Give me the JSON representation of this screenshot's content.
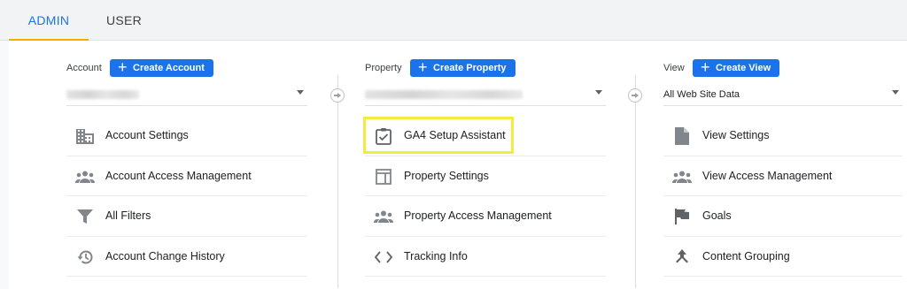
{
  "tabs": [
    {
      "label": "ADMIN",
      "active": true
    },
    {
      "label": "USER",
      "active": false
    }
  ],
  "colors": {
    "accent": "#1a73e8",
    "tab_underline": "#f9ab00",
    "highlight": "#f1ec41",
    "icon": "#80868b"
  },
  "columns": {
    "account": {
      "header": "Account",
      "create_label": "Create Account",
      "selected_value": "",
      "items": [
        {
          "label": "Account Settings",
          "icon": "building-icon"
        },
        {
          "label": "Account Access Management",
          "icon": "people-icon"
        },
        {
          "label": "All Filters",
          "icon": "filter-icon"
        },
        {
          "label": "Account Change History",
          "icon": "history-icon"
        }
      ]
    },
    "property": {
      "header": "Property",
      "create_label": "Create Property",
      "selected_value": "",
      "items": [
        {
          "label": "GA4 Setup Assistant",
          "icon": "clipboard-check-icon"
        },
        {
          "label": "Property Settings",
          "icon": "layout-icon"
        },
        {
          "label": "Property Access Management",
          "icon": "people-icon"
        },
        {
          "label": "Tracking Info",
          "icon": "code-icon"
        }
      ]
    },
    "view": {
      "header": "View",
      "create_label": "Create View",
      "selected_value": "All Web Site Data",
      "items": [
        {
          "label": "View Settings",
          "icon": "document-icon"
        },
        {
          "label": "View Access Management",
          "icon": "people-icon"
        },
        {
          "label": "Goals",
          "icon": "flag-icon"
        },
        {
          "label": "Content Grouping",
          "icon": "grouping-icon"
        }
      ]
    }
  }
}
